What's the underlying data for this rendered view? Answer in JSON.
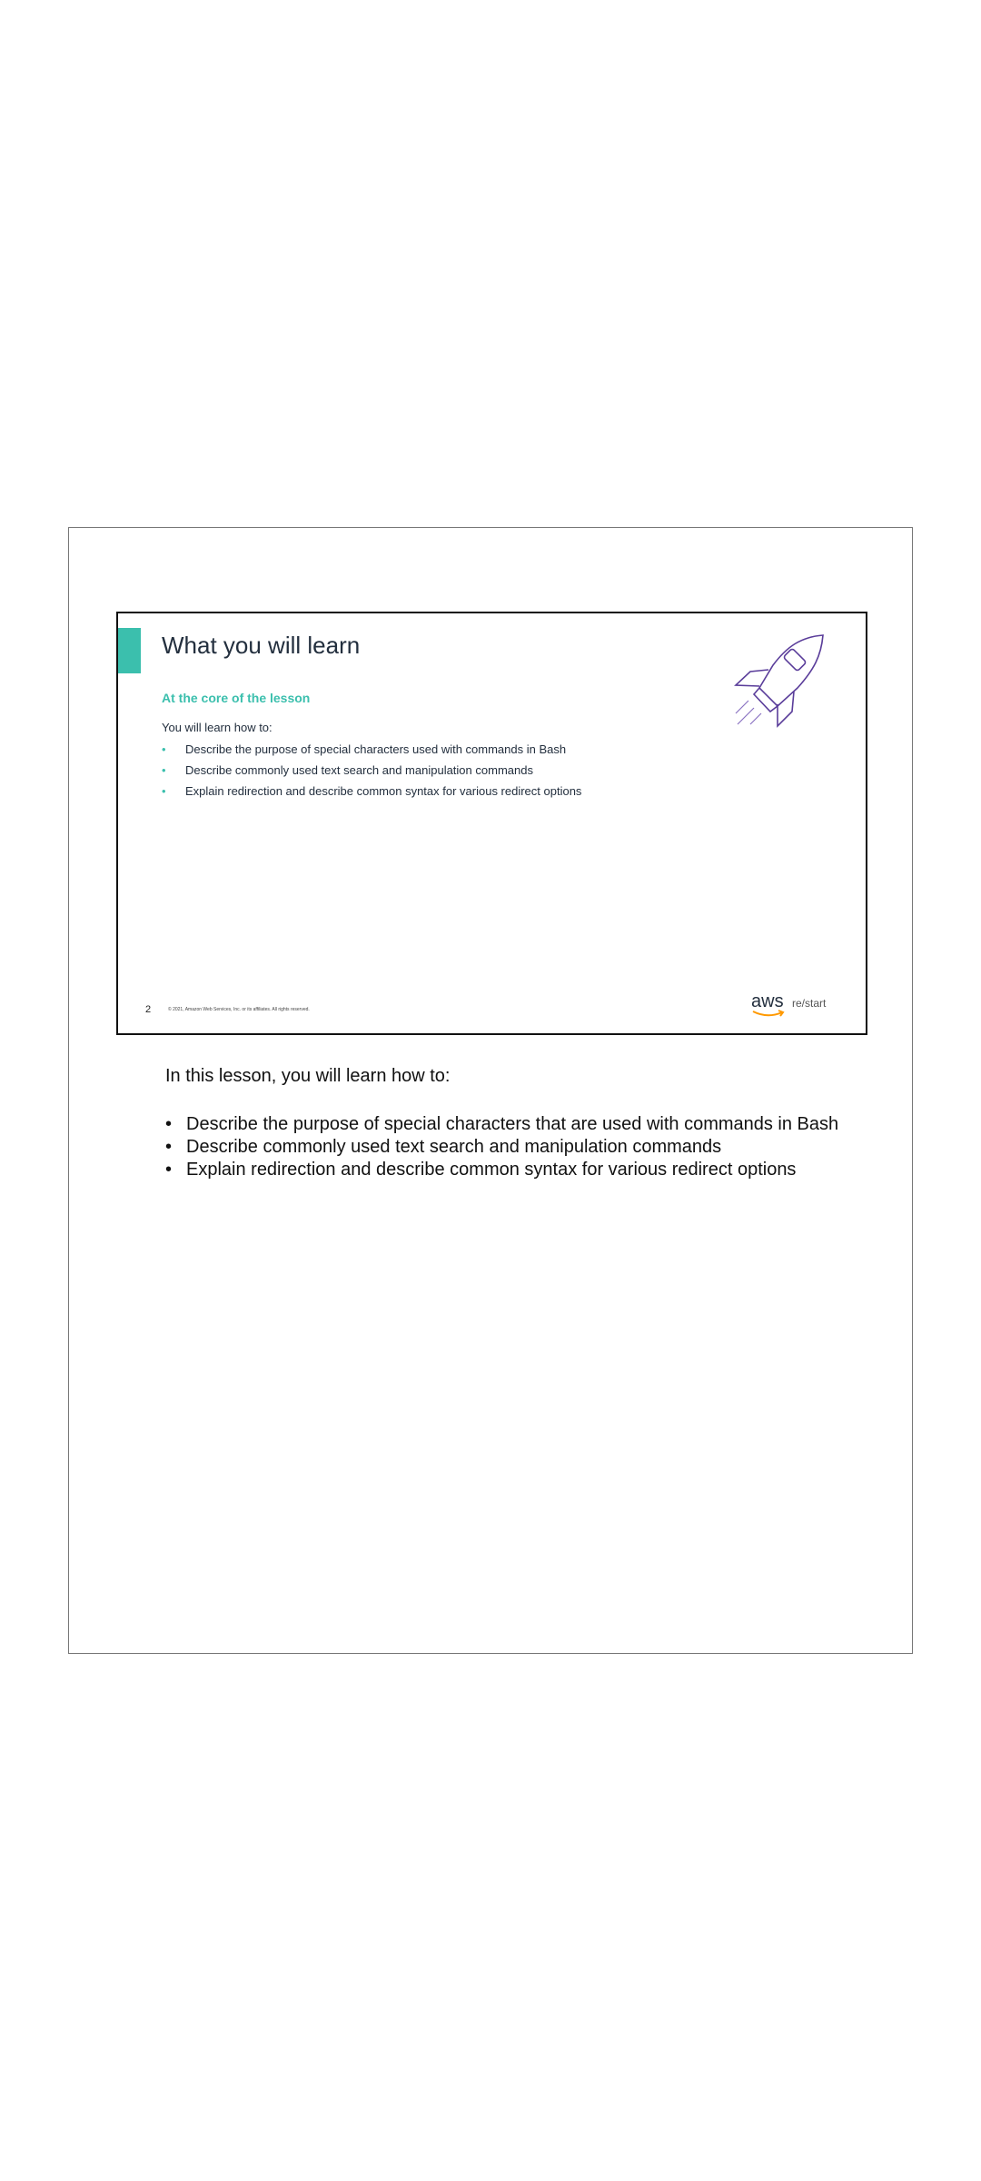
{
  "slide": {
    "title": "What you will learn",
    "subtitle": "At the core of the lesson",
    "intro": "You will learn how to:",
    "bullets": [
      "Describe the purpose of special characters used with commands in Bash",
      "Describe commonly used text search and manipulation commands",
      "Explain redirection and describe common syntax for various redirect options"
    ],
    "page_number": "2",
    "copyright": "© 2021, Amazon Web Services, Inc. or its affiliates. All rights reserved.",
    "logo_aws": "aws",
    "logo_product": "re/start",
    "icon": "rocket-icon",
    "colors": {
      "accent": "#3bbfad",
      "rocket": "#5a3d9a"
    }
  },
  "notes": {
    "intro": "In this lesson, you will learn how to:",
    "bullets": [
      "Describe the purpose of special characters that are used with commands in Bash",
      "Describe commonly used text search and manipulation commands",
      "Explain redirection and describe common syntax for various redirect options"
    ]
  }
}
